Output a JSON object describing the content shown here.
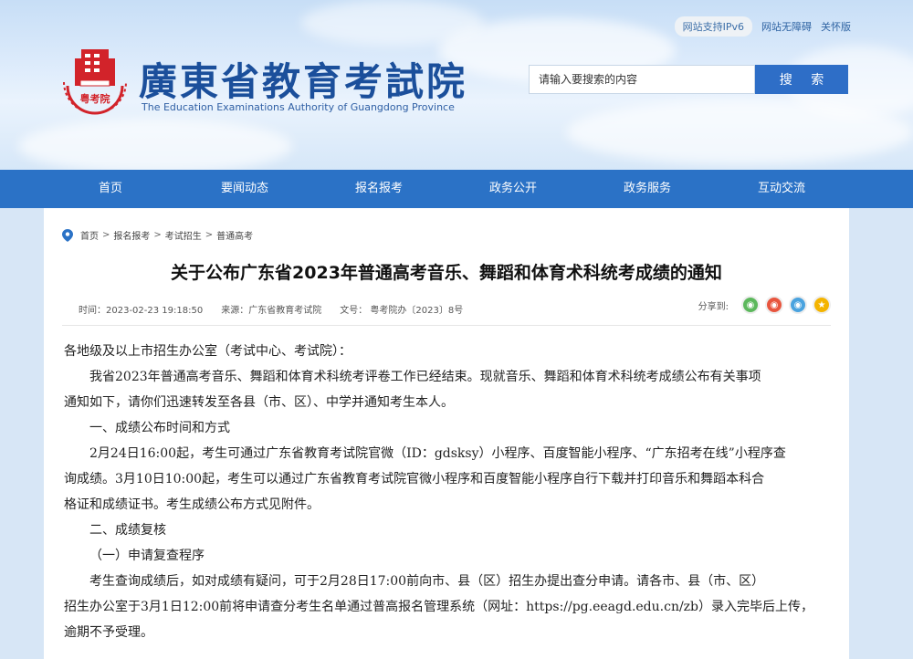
{
  "header": {
    "ipv6_badge": "网站支持IPv6",
    "accessibility_link": "网站无障碍",
    "care_link": "关怀版",
    "logo_title": "廣東省教育考試院",
    "logo_subtitle": "The Education Examinations Authority of Guangdong Province",
    "emblem_text": "粤考院",
    "search_placeholder": "请输入要搜索的内容",
    "search_button": "搜 索"
  },
  "nav": {
    "items": [
      {
        "label": "首页"
      },
      {
        "label": "要闻动态"
      },
      {
        "label": "报名报考"
      },
      {
        "label": "政务公开"
      },
      {
        "label": "政务服务"
      },
      {
        "label": "互动交流"
      }
    ]
  },
  "breadcrumb": {
    "items": [
      "首页",
      "报名报考",
      "考试招生",
      "普通高考"
    ],
    "separator": ">"
  },
  "article": {
    "title": "关于公布广东省2023年普通高考音乐、舞蹈和体育术科统考成绩的通知",
    "meta_time": "时间：2023-02-23 19:18:50",
    "meta_source": "来源：广东省教育考试院",
    "meta_docno": "文号： 粤考院办〔2023〕8号",
    "share_label": "分享到:",
    "share_icons": [
      {
        "name": "wechat-icon",
        "color": "#5cb85c",
        "glyph": "◉"
      },
      {
        "name": "weibo-icon",
        "color": "#e8553e",
        "glyph": "◉"
      },
      {
        "name": "qq-icon",
        "color": "#4aa3df",
        "glyph": "◉"
      },
      {
        "name": "qzone-icon",
        "color": "#f4b400",
        "glyph": "★"
      }
    ],
    "lines": [
      "各地级及以上市招生办公室（考试中心、考试院）：",
      "我省2023年普通高考音乐、舞蹈和体育术科统考评卷工作已经结束。现就音乐、舞蹈和体育术科统考成绩公布有关事项",
      "通知如下，请你们迅速转发至各县（市、区）、中学并通知考生本人。",
      "一、成绩公布时间和方式",
      "2月24日16:00起，考生可通过广东省教育考试院官微（ID：gdsksy）小程序、百度智能小程序、“广东招考在线”小程序查",
      "询成绩。3月10日10:00起，考生可以通过广东省教育考试院官微小程序和百度智能小程序自行下载并打印音乐和舞蹈本科合",
      "格证和成绩证书。考生成绩公布方式见附件。",
      "二、成绩复核",
      "（一）申请复查程序",
      "考生查询成绩后，如对成绩有疑问，可于2月28日17:00前向市、县（区）招生办提出查分申请。请各市、县（市、区）",
      "招生办公室于3月1日12:00前将申请查分考生名单通过普高报名管理系统（网址：https://pg.eeagd.edu.cn/zb）录入完毕后上传，",
      "逾期不予受理。"
    ]
  }
}
